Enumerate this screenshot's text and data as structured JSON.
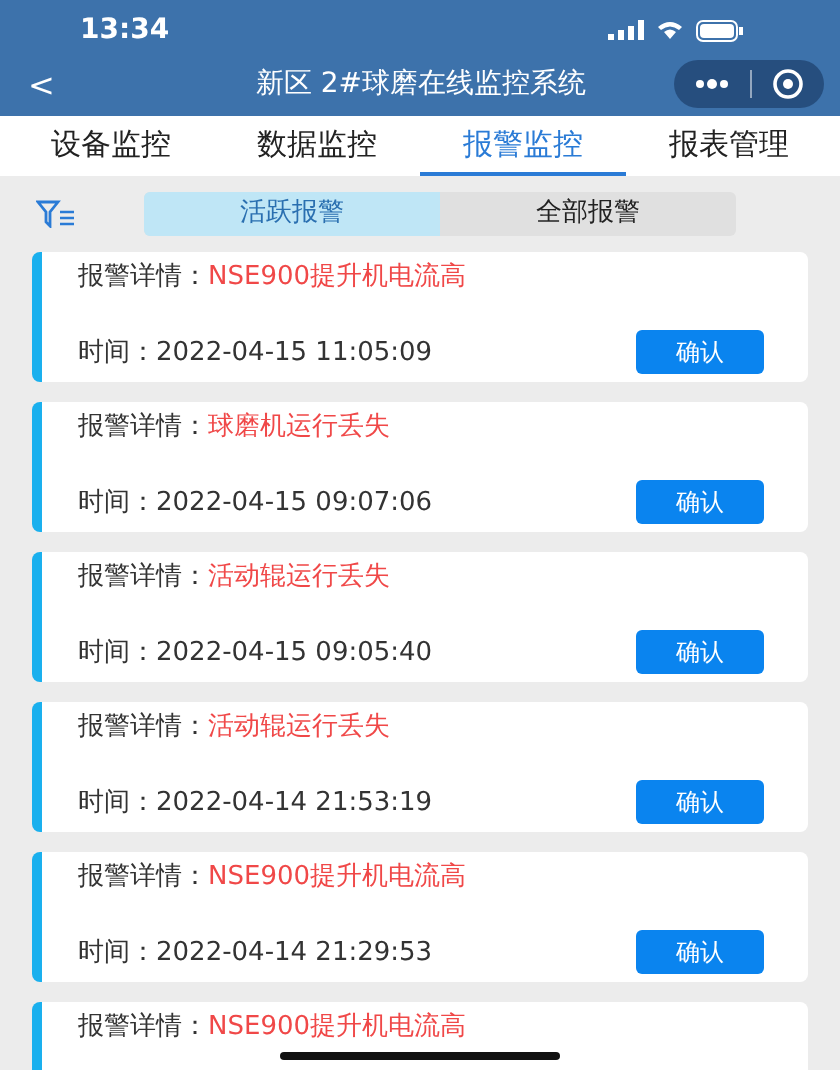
{
  "status_bar": {
    "time": "13:34"
  },
  "nav": {
    "back": "<",
    "title": "新区 2#球磨在线监控系统"
  },
  "tabs": [
    {
      "label": "设备监控",
      "selected": false
    },
    {
      "label": "数据监控",
      "selected": false
    },
    {
      "label": "报警监控",
      "selected": true
    },
    {
      "label": "报表管理",
      "selected": false
    }
  ],
  "segments": [
    {
      "label": "活跃报警",
      "selected": true
    },
    {
      "label": "全部报警",
      "selected": false
    }
  ],
  "alarms": [
    {
      "detail_label": "报警详情：",
      "detail": "NSE900提升机电流高",
      "time_label": "时间：",
      "time": "2022-04-15 11:05:09",
      "button": "确认"
    },
    {
      "detail_label": "报警详情：",
      "detail": "球磨机运行丢失",
      "time_label": "时间：",
      "time": "2022-04-15 09:07:06",
      "button": "确认"
    },
    {
      "detail_label": "报警详情：",
      "detail": "活动辊运行丢失",
      "time_label": "时间：",
      "time": "2022-04-15 09:05:40",
      "button": "确认"
    },
    {
      "detail_label": "报警详情：",
      "detail": "活动辊运行丢失",
      "time_label": "时间：",
      "time": "2022-04-14 21:53:19",
      "button": "确认"
    },
    {
      "detail_label": "报警详情：",
      "detail": "NSE900提升机电流高",
      "time_label": "时间：",
      "time": "2022-04-14 21:29:53",
      "button": "确认"
    },
    {
      "detail_label": "报警详情：",
      "detail": "NSE900提升机电流高"
    }
  ]
}
